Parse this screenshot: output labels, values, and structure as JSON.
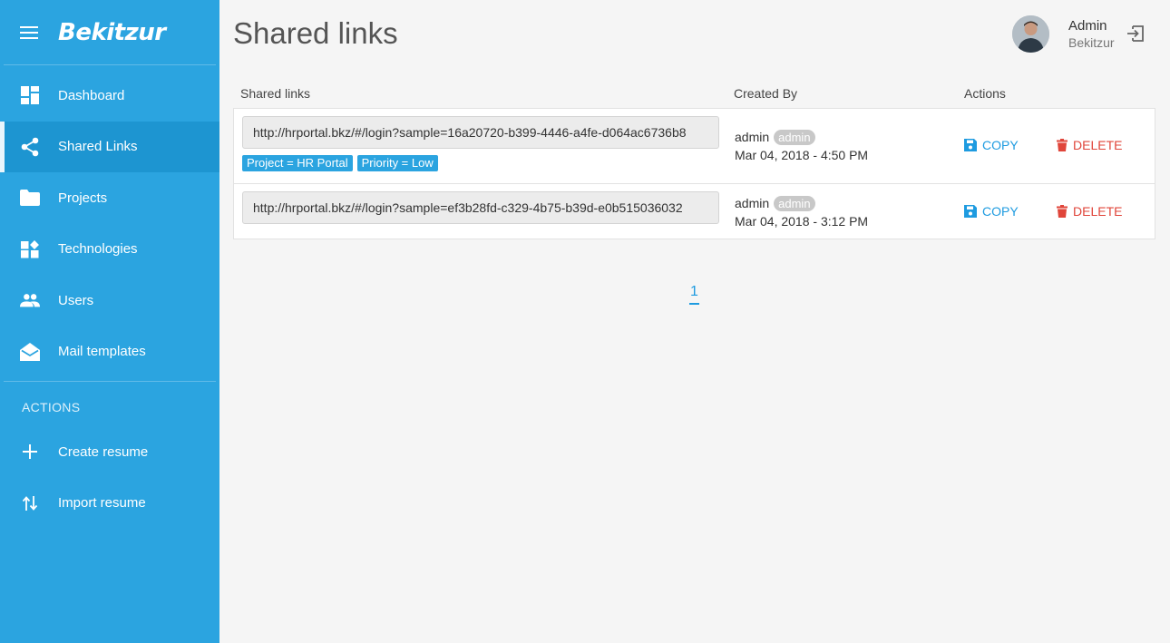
{
  "brand": "Bekitzur",
  "sidebar": {
    "items": [
      {
        "label": "Dashboard",
        "icon": "dashboard-icon"
      },
      {
        "label": "Shared Links",
        "icon": "share-icon"
      },
      {
        "label": "Projects",
        "icon": "folder-icon"
      },
      {
        "label": "Technologies",
        "icon": "widgets-icon"
      },
      {
        "label": "Users",
        "icon": "people-icon"
      },
      {
        "label": "Mail templates",
        "icon": "mail-icon"
      }
    ],
    "section_label": "ACTIONS",
    "actions": [
      {
        "label": "Create resume",
        "icon": "plus-icon"
      },
      {
        "label": "Import resume",
        "icon": "import-icon"
      }
    ]
  },
  "page": {
    "title": "Shared links"
  },
  "user": {
    "name": "Admin",
    "org": "Bekitzur"
  },
  "table": {
    "headers": {
      "link": "Shared links",
      "created_by": "Created By",
      "actions": "Actions"
    },
    "rows": [
      {
        "url": "http://hrportal.bkz/#/login?sample=16a20720-b399-4446-a4fe-d064ac6736b8",
        "tags": [
          "Project = HR Portal",
          "Priority = Low"
        ],
        "creator": "admin",
        "role": "admin",
        "created": "Mar 04, 2018 - 4:50 PM",
        "copy": "COPY",
        "delete": "DELETE"
      },
      {
        "url": "http://hrportal.bkz/#/login?sample=ef3b28fd-c329-4b75-b39d-e0b515036032",
        "tags": [],
        "creator": "admin",
        "role": "admin",
        "created": "Mar 04, 2018 - 3:12 PM",
        "copy": "COPY",
        "delete": "DELETE"
      }
    ]
  },
  "pagination": {
    "current": "1"
  },
  "colors": {
    "sidebar": "#2ba4e0",
    "accent": "#1e9be0",
    "danger": "#e0453a"
  }
}
